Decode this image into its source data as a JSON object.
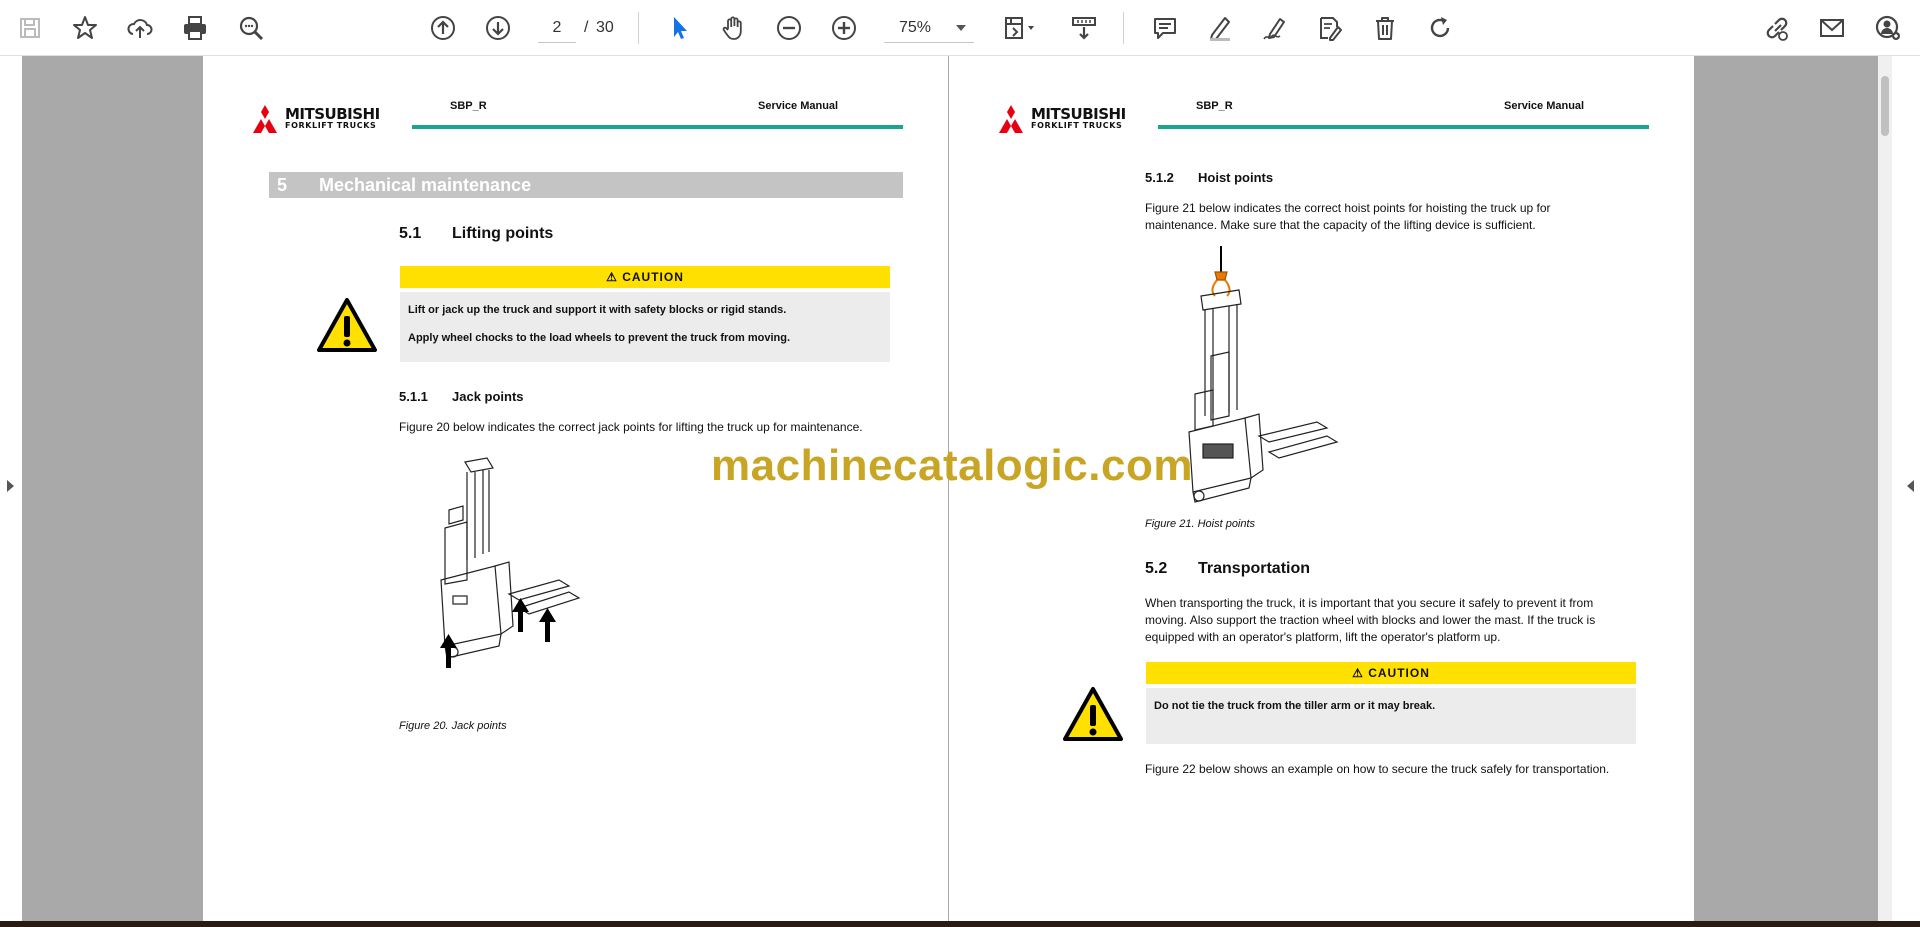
{
  "toolbar": {
    "current_page": "2",
    "separator": "/",
    "total_pages": "30",
    "zoom": "75%",
    "icons": [
      "save-icon",
      "bookmark-star-icon",
      "upload-cloud-icon",
      "print-icon",
      "search-zoom-icon",
      "page-up-icon",
      "page-down-icon",
      "select-cursor-icon",
      "hand-icon",
      "zoom-out-icon",
      "zoom-in-icon",
      "fit-page-icon",
      "scroll-mode-icon",
      "comment-icon",
      "highlight-pen-icon",
      "sign-icon",
      "edit-document-icon",
      "delete-icon",
      "rotate-icon",
      "link-icon",
      "email-icon",
      "account-icon"
    ]
  },
  "left_page": {
    "header": {
      "brand": "MITSUBISHI",
      "brand_sub": "FORKLIFT TRUCKS",
      "code": "SBP_R",
      "manual": "Service Manual"
    },
    "chapter": {
      "number": "5",
      "title": "Mechanical maintenance"
    },
    "section": {
      "number": "5.1",
      "title": "Lifting points"
    },
    "caution": {
      "label": "CAUTION",
      "lines": [
        "Lift or jack up the truck and support it with safety blocks or rigid stands.",
        "Apply wheel chocks to the load wheels to prevent the truck from moving."
      ]
    },
    "subsection": {
      "number": "5.1.1",
      "title": "Jack points"
    },
    "paragraph": "Figure 20 below indicates the correct jack points for lifting the truck up for maintenance.",
    "figure_caption": "Figure 20. Jack points"
  },
  "right_page": {
    "header": {
      "brand": "MITSUBISHI",
      "brand_sub": "FORKLIFT TRUCKS",
      "code": "SBP_R",
      "manual": "Service Manual"
    },
    "subsection": {
      "number": "5.1.2",
      "title": "Hoist points"
    },
    "paragraph1": "Figure 21 below indicates the correct hoist points for hoisting the truck up for maintenance. Make sure that the capacity of the lifting device is sufficient.",
    "figure_caption": "Figure 21. Hoist points",
    "section": {
      "number": "5.2",
      "title": "Transportation"
    },
    "paragraph2": "When transporting the truck, it is important that you secure it safely to prevent it from moving. Also support the traction wheel with blocks and lower the mast. If the truck is equipped with an operator's platform, lift the operator's platform up.",
    "caution": {
      "label": "CAUTION",
      "lines": [
        "Do not tie the truck from the tiller arm or it may break."
      ]
    },
    "paragraph3": "Figure 22 below shows an example on how to secure the truck safely for transportation."
  },
  "watermark": "machinecatalogic.com",
  "colors": {
    "canvas": "#a9a9a9",
    "caution_yellow": "#ffe000",
    "header_rule": "#1aa58c",
    "chapter_bar": "#c4c4c4",
    "watermark": "#c6a11a",
    "brand_red": "#e60012"
  }
}
